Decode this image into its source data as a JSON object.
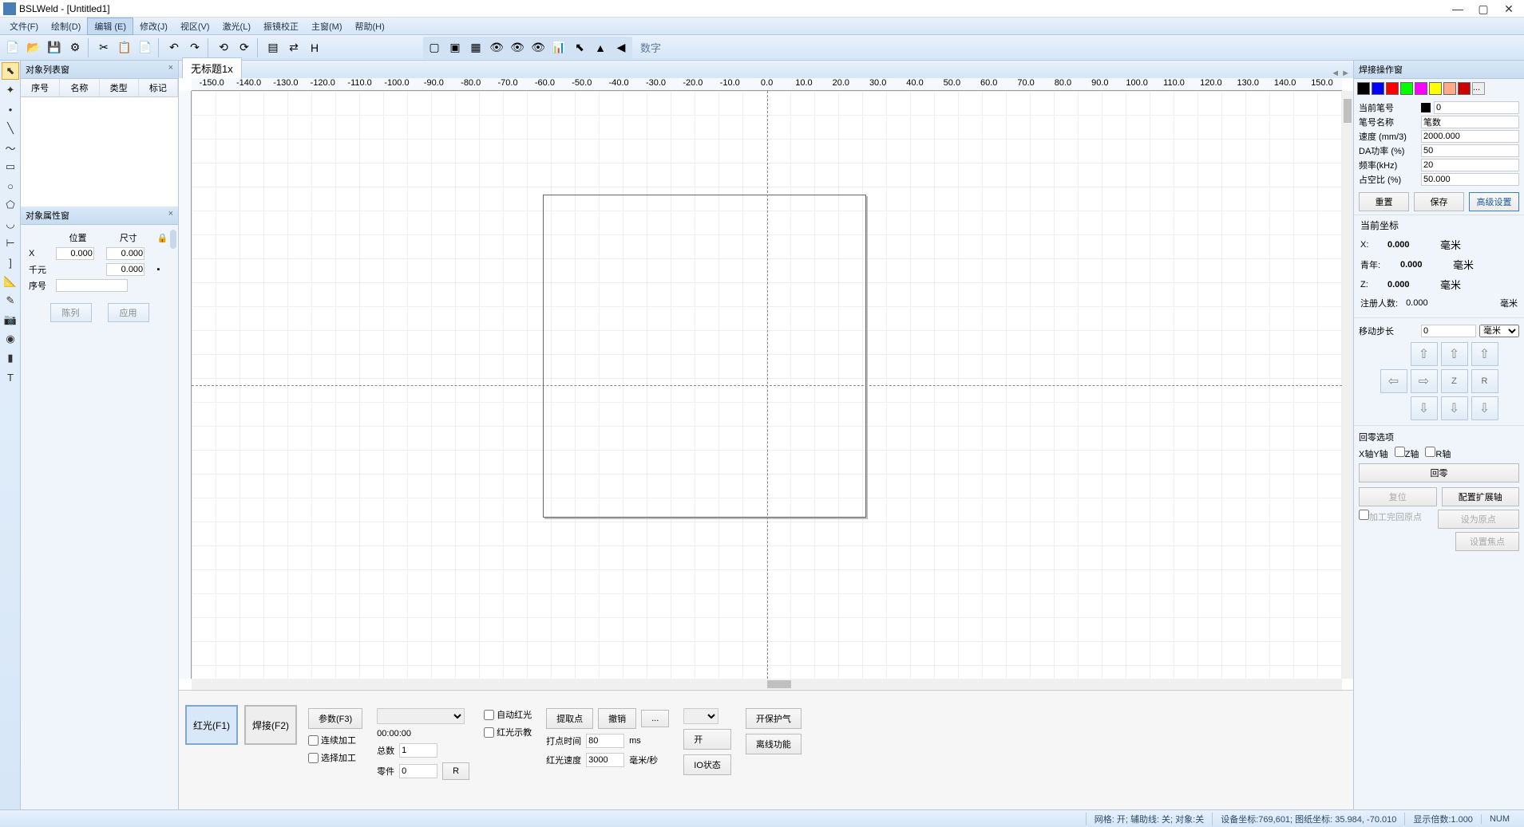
{
  "app": {
    "title": "BSLWeld - [Untitled1]"
  },
  "menu": {
    "file": "文件(F)",
    "draw": "绘制(D)",
    "edit": "编辑 (E)",
    "modify": "修改(J)",
    "view": "视区(V)",
    "laser": "激光(L)",
    "galvo": "振镜校正",
    "main": "主窗(M)",
    "help": "帮助(H)"
  },
  "toolbar": {
    "digit": "数字"
  },
  "tab": {
    "title": "无标题1x"
  },
  "objlist": {
    "title": "对象列表窗",
    "col_seq": "序号",
    "col_name": "名称",
    "col_type": "类型",
    "col_mark": "标记"
  },
  "objprop": {
    "title": "对象属性窗",
    "pos": "位置",
    "size": "尺寸",
    "x": "X",
    "x_pos": "0.000",
    "x_size": "0.000",
    "qy": "千元",
    "qy_size": "0.000",
    "seq": "序号",
    "btn_arr": "陈列",
    "btn_apply": "应用"
  },
  "bottom": {
    "red": "红光(F1)",
    "weld": "焊接(F2)",
    "params": "参数(F3)",
    "continuous": "连续加工",
    "select": "选择加工",
    "time": "00:00:00",
    "total_lbl": "总数",
    "total_val": "1",
    "parts_lbl": "零件",
    "parts_val": "0",
    "r_btn": "R",
    "auto_red": "自动红光",
    "red_teach": "红光示教",
    "getpt": "提取点",
    "undo": "撤销",
    "more": "...",
    "dot_time_lbl": "打点时间",
    "dot_time_val": "80",
    "ms": "ms",
    "red_speed_lbl": "红光速度",
    "red_speed_val": "3000",
    "mmps": "毫米/秒",
    "open_btn": "开",
    "io_btn": "IO状态",
    "shield_gas": "开保护气",
    "offline": "离线功能"
  },
  "right": {
    "title": "焊接操作窗",
    "colors": [
      "#000000",
      "#0000ff",
      "#ff0000",
      "#00ff00",
      "#ff00ff",
      "#ffff00",
      "#ffaa88",
      "#cc0000"
    ],
    "more_colors": "...",
    "cur_pen_lbl": "当前笔号",
    "cur_pen_val": "0",
    "pen_name_lbl": "笔号名称",
    "pen_name_val": "笔数",
    "speed_lbl": "速度 (mm/3)",
    "speed_val": "2000.000",
    "da_lbl": "DA功率 (%)",
    "da_val": "50",
    "freq_lbl": "频率(kHz)",
    "freq_val": "20",
    "duty_lbl": "占空比 (%)",
    "duty_val": "50.000",
    "btn_reset": "重置",
    "btn_save": "保存",
    "btn_adv": "高级设置",
    "coord_title": "当前坐标",
    "x_lbl": "X:",
    "x_val": "0.000",
    "y_lbl": "青年:",
    "y_val": "0.000",
    "z_lbl": "Z:",
    "z_val": "0.000",
    "reg_lbl": "注册人数:",
    "reg_val": "0.000",
    "unit": "毫米",
    "step_lbl": "移动步长",
    "step_val": "0",
    "step_unit": "毫米",
    "axis_z": "Z",
    "axis_r": "R",
    "home_title": "回零选项",
    "xy_axis": "X轴Y轴",
    "z_axis": "Z轴",
    "r_axis": "R轴",
    "home_btn": "回零",
    "reset_pos": "复位",
    "cfg_ext": "配置扩展轴",
    "proc_origin": "加工完回原点",
    "set_origin": "设为原点",
    "set_focus": "设置焦点"
  },
  "status": {
    "grid": "网格: 开; 辅助线: 关; 对象:关",
    "dev_coord": "设备坐标:769,601; 图纸坐标: 35.984, -70.010",
    "zoom": "显示倍数:1.000",
    "num": "NUM"
  },
  "ruler_marks": [
    "-150.0",
    "-140.0",
    "-130.0",
    "-120.0",
    "-110.0",
    "-100.0",
    "-90.0",
    "-80.0",
    "-70.0",
    "-60.0",
    "-50.0",
    "-40.0",
    "-30.0",
    "-20.0",
    "-10.0",
    "0.0",
    "10.0",
    "20.0",
    "30.0",
    "40.0",
    "50.0",
    "60.0",
    "70.0",
    "80.0",
    "90.0",
    "100.0",
    "110.0",
    "120.0",
    "130.0",
    "140.0",
    "150.0"
  ]
}
